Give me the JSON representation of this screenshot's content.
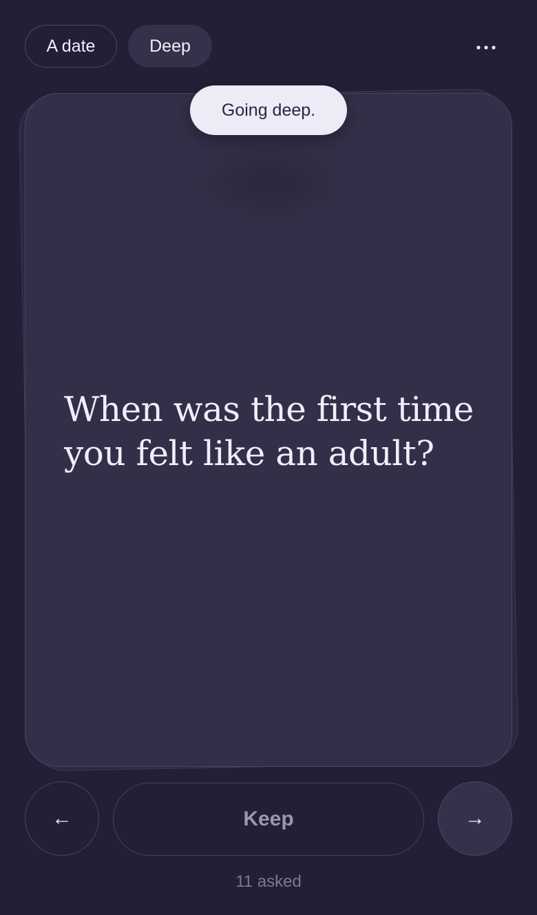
{
  "header": {
    "context_chip": "A date",
    "mode_chip": "Deep",
    "more_icon": "more-horizontal-icon"
  },
  "toast": {
    "text": "Going deep."
  },
  "card": {
    "question": "When was the first time you felt like an adult?"
  },
  "controls": {
    "prev_glyph": "←",
    "keep_label": "Keep",
    "next_glyph": "→"
  },
  "footer": {
    "asked_label": "11 asked"
  },
  "colors": {
    "background": "#231f37",
    "card": "#342f48",
    "toast_bg": "#eeeaf6",
    "text": "#f1edf9",
    "muted": "#7d7894"
  }
}
